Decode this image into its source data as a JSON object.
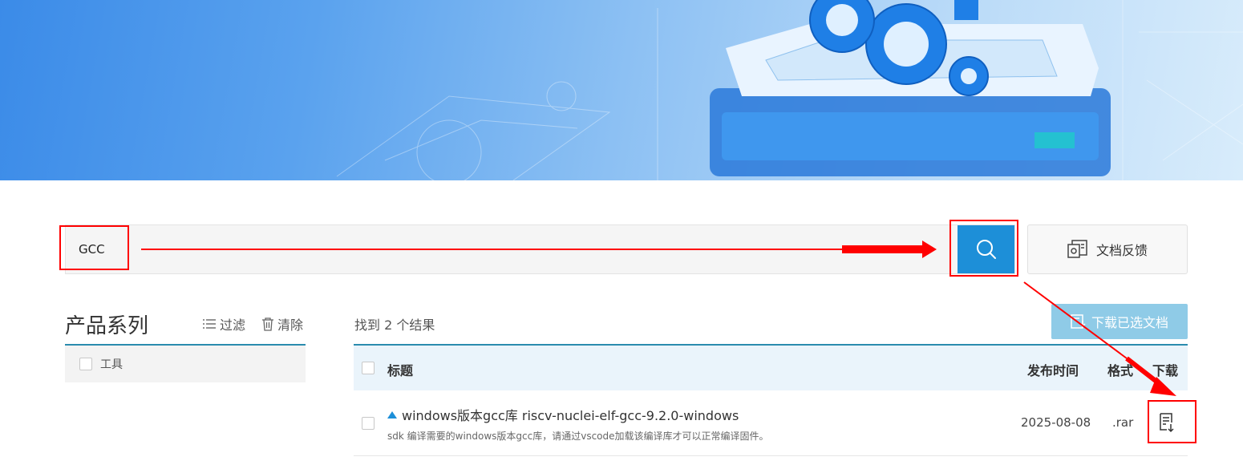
{
  "search": {
    "value": "GCC"
  },
  "feedback": {
    "label": "文档反馈"
  },
  "sidebar": {
    "title": "产品系列",
    "filter_label": "过滤",
    "clear_label": "清除",
    "items": [
      {
        "label": "工具"
      }
    ]
  },
  "results": {
    "count_text": "找到 2 个结果",
    "download_selected_label": "下载已选文档",
    "columns": {
      "title": "标题",
      "date": "发布时间",
      "format": "格式",
      "download": "下载"
    },
    "rows": [
      {
        "title": "windows版本gcc库 riscv-nuclei-elf-gcc-9.2.0-windows",
        "description": "sdk 编译需要的windows版本gcc库，请通过vscode加载该编译库才可以正常编译固件。",
        "date": "2025-08-08",
        "format": ".rar"
      }
    ]
  },
  "colors": {
    "accent": "#1d8fd8",
    "annotation": "#ff0000",
    "header_line": "#2a8cae"
  },
  "icons": [
    "search-icon",
    "feedback-icon",
    "filter-icon",
    "trash-icon",
    "download-doc-icon",
    "file-download-icon"
  ]
}
